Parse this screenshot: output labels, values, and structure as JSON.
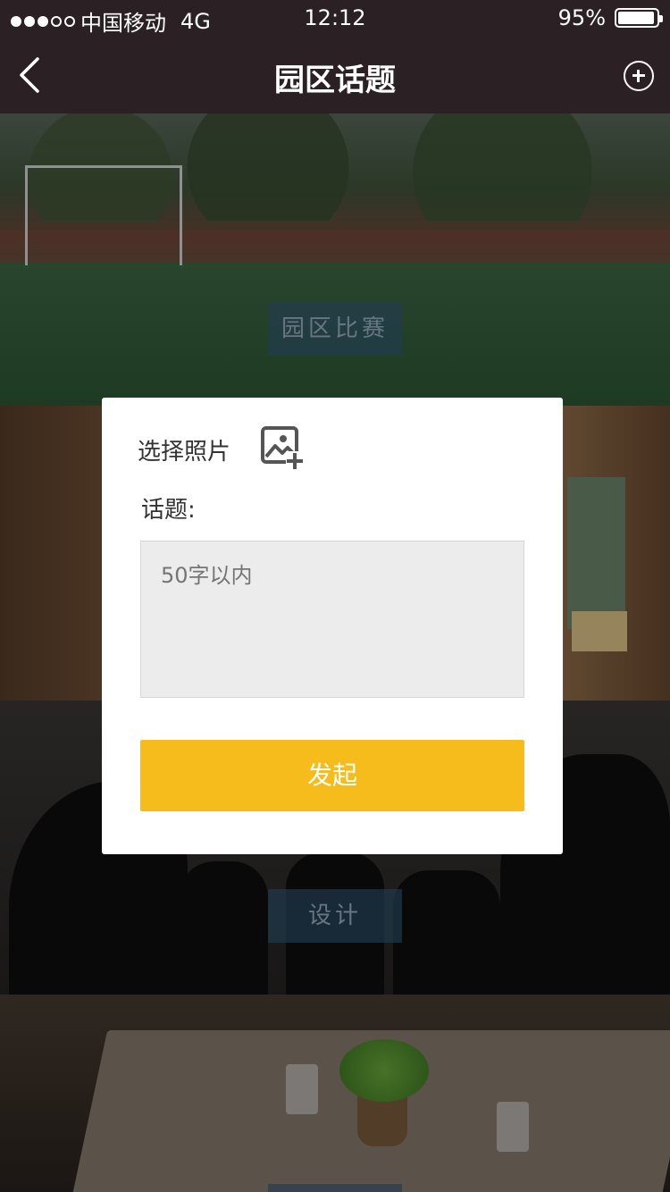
{
  "status_bar": {
    "carrier": "中国移动",
    "network": "4G",
    "time": "12:12",
    "battery": "95%",
    "battery_level": 0.95
  },
  "nav": {
    "title": "园区话题",
    "back_icon": "chevron-left-icon",
    "add_icon": "plus-circle-icon"
  },
  "cards": [
    {
      "tag": "园区比赛"
    },
    {
      "tag": ""
    },
    {
      "tag": "设计"
    },
    {
      "tag": ""
    }
  ],
  "dialog": {
    "select_photo_label": "选择照片",
    "photo_icon": "add-photo-icon",
    "topic_label": "话题:",
    "topic_placeholder": "50字以内",
    "submit_label": "发起"
  },
  "colors": {
    "nav_bg": "#2b2125",
    "accent": "#f6bc1c",
    "tag_bg": "#345c7d"
  }
}
